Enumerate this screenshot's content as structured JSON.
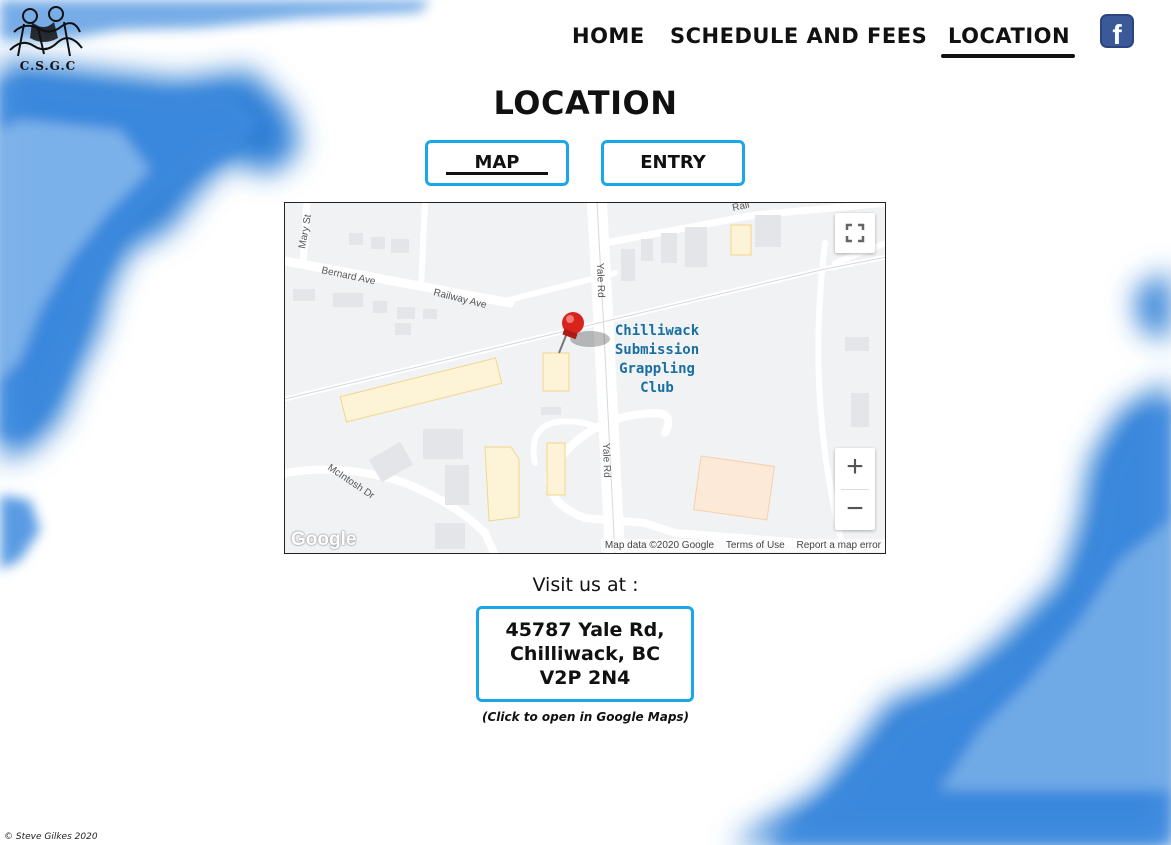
{
  "brand": {
    "logo_text": "C.S.G.C"
  },
  "nav": {
    "items": [
      {
        "label": "HOME"
      },
      {
        "label": "SCHEDULE AND FEES"
      },
      {
        "label": "LOCATION",
        "active": true
      }
    ],
    "facebook_label": "f"
  },
  "page": {
    "title": "LOCATION"
  },
  "tabs": [
    {
      "label": "MAP",
      "active": true
    },
    {
      "label": "ENTRY"
    }
  ],
  "map": {
    "place_label_lines": [
      "Chilliwack",
      "Submission",
      "Grappling",
      "Club"
    ],
    "streets": [
      "Mary St",
      "Bernard Ave",
      "Railway Ave",
      "Yale Rd",
      "Yale Rd",
      "McIntosh Dr",
      "Rail"
    ],
    "zoom_in": "+",
    "zoom_out": "−",
    "google_logo": "Google",
    "footer": [
      "Map data ©2020 Google",
      "Terms of Use",
      "Report a map error"
    ]
  },
  "address": {
    "intro": "Visit us at :",
    "lines": [
      "45787 Yale Rd,",
      "Chilliwack, BC",
      "V2P 2N4"
    ],
    "hint": "(Click to open in Google Maps)"
  },
  "footer": {
    "copyright": "© Steve Gilkes 2020"
  },
  "colors": {
    "accent": "#1aa7e8",
    "cloud": "#2f7fd6",
    "facebook": "#3b5998",
    "map_label": "#1a6fa0"
  }
}
